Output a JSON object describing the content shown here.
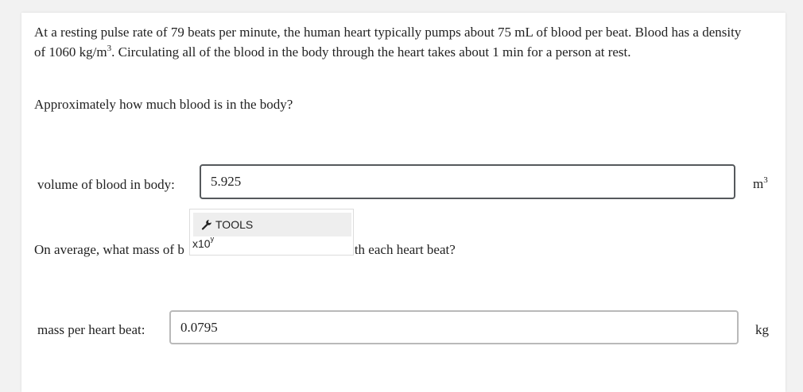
{
  "problem": {
    "text_line1": "At a resting pulse rate of 79 beats per minute, the human heart typically pumps about 75 mL of blood per beat. Blood has a density of 1060 kg/m",
    "density_exponent": "3",
    "text_line2": ". Circulating all of the blood in the body through the heart takes about 1 min for a person at rest."
  },
  "questions": [
    {
      "prompt": "Approximately how much blood is in the body?",
      "label": "volume of blood in body:",
      "value": "5.925",
      "unit_base": "m",
      "unit_exponent": "3"
    },
    {
      "prompt_start": "On average, what mass of b",
      "prompt_end": "th each heart beat?",
      "label": "mass per heart beat:",
      "value": "0.0795",
      "unit": "kg"
    }
  ],
  "tools_popup": {
    "header_label": "TOOLS",
    "button_base": "x10",
    "button_exponent": "y",
    "icons": {
      "header": "wrench-icon"
    }
  },
  "colors": {
    "focused_border": "#55595c",
    "input_border": "#b9b9b9",
    "popup_header_bg": "#eeeeee"
  }
}
